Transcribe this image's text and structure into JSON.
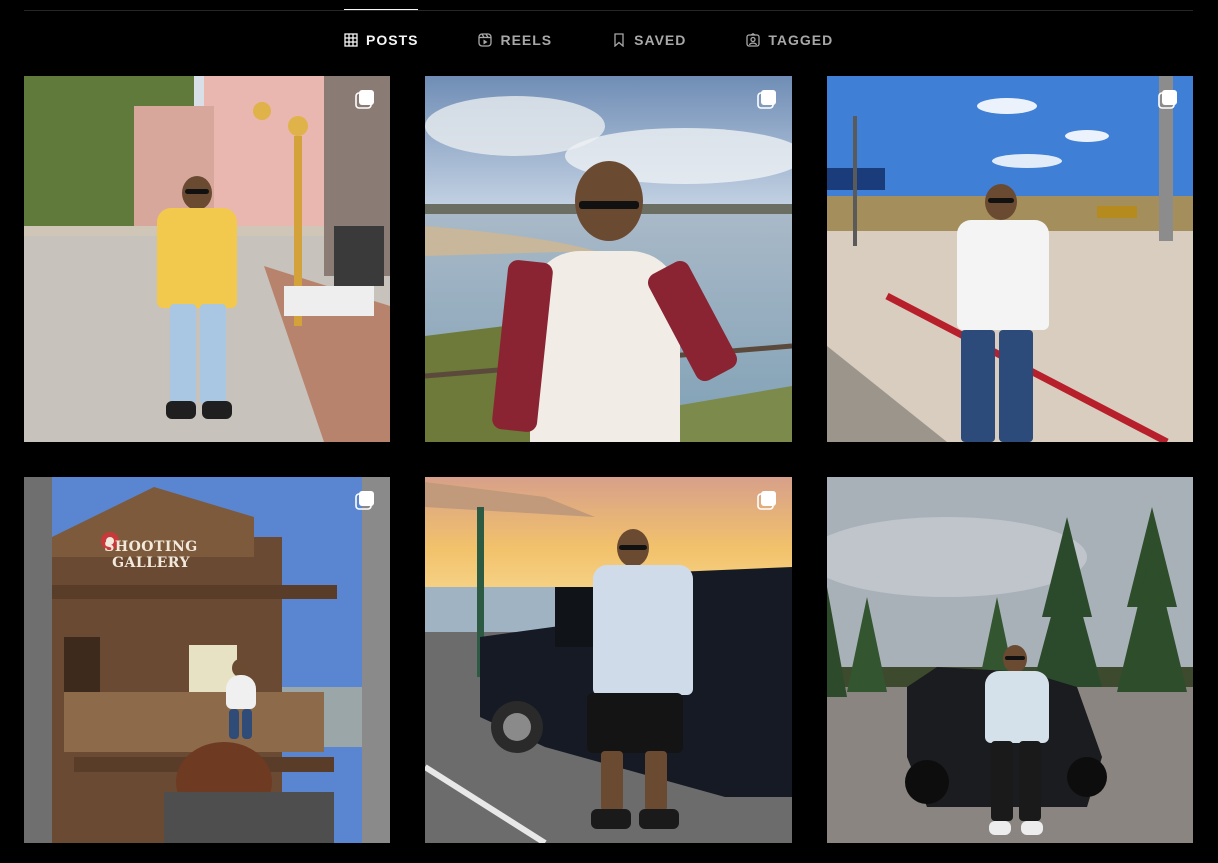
{
  "tabs": [
    {
      "label": "POSTS",
      "icon": "grid-icon",
      "active": true
    },
    {
      "label": "REELS",
      "icon": "reels-icon",
      "active": false
    },
    {
      "label": "SAVED",
      "icon": "bookmark-icon",
      "active": false
    },
    {
      "label": "TAGGED",
      "icon": "tag-user-icon",
      "active": false
    }
  ],
  "posts": [
    {
      "multiple_images": true
    },
    {
      "multiple_images": true
    },
    {
      "multiple_images": true
    },
    {
      "multiple_images": true,
      "sign_text": "SHOOTING GALLERY"
    },
    {
      "multiple_images": true
    },
    {
      "multiple_images": false
    }
  ],
  "colors": {
    "background": "#000000",
    "tab_active": "#f5f5f5",
    "tab_inactive": "#a8a8a8",
    "divider": "#262626"
  }
}
